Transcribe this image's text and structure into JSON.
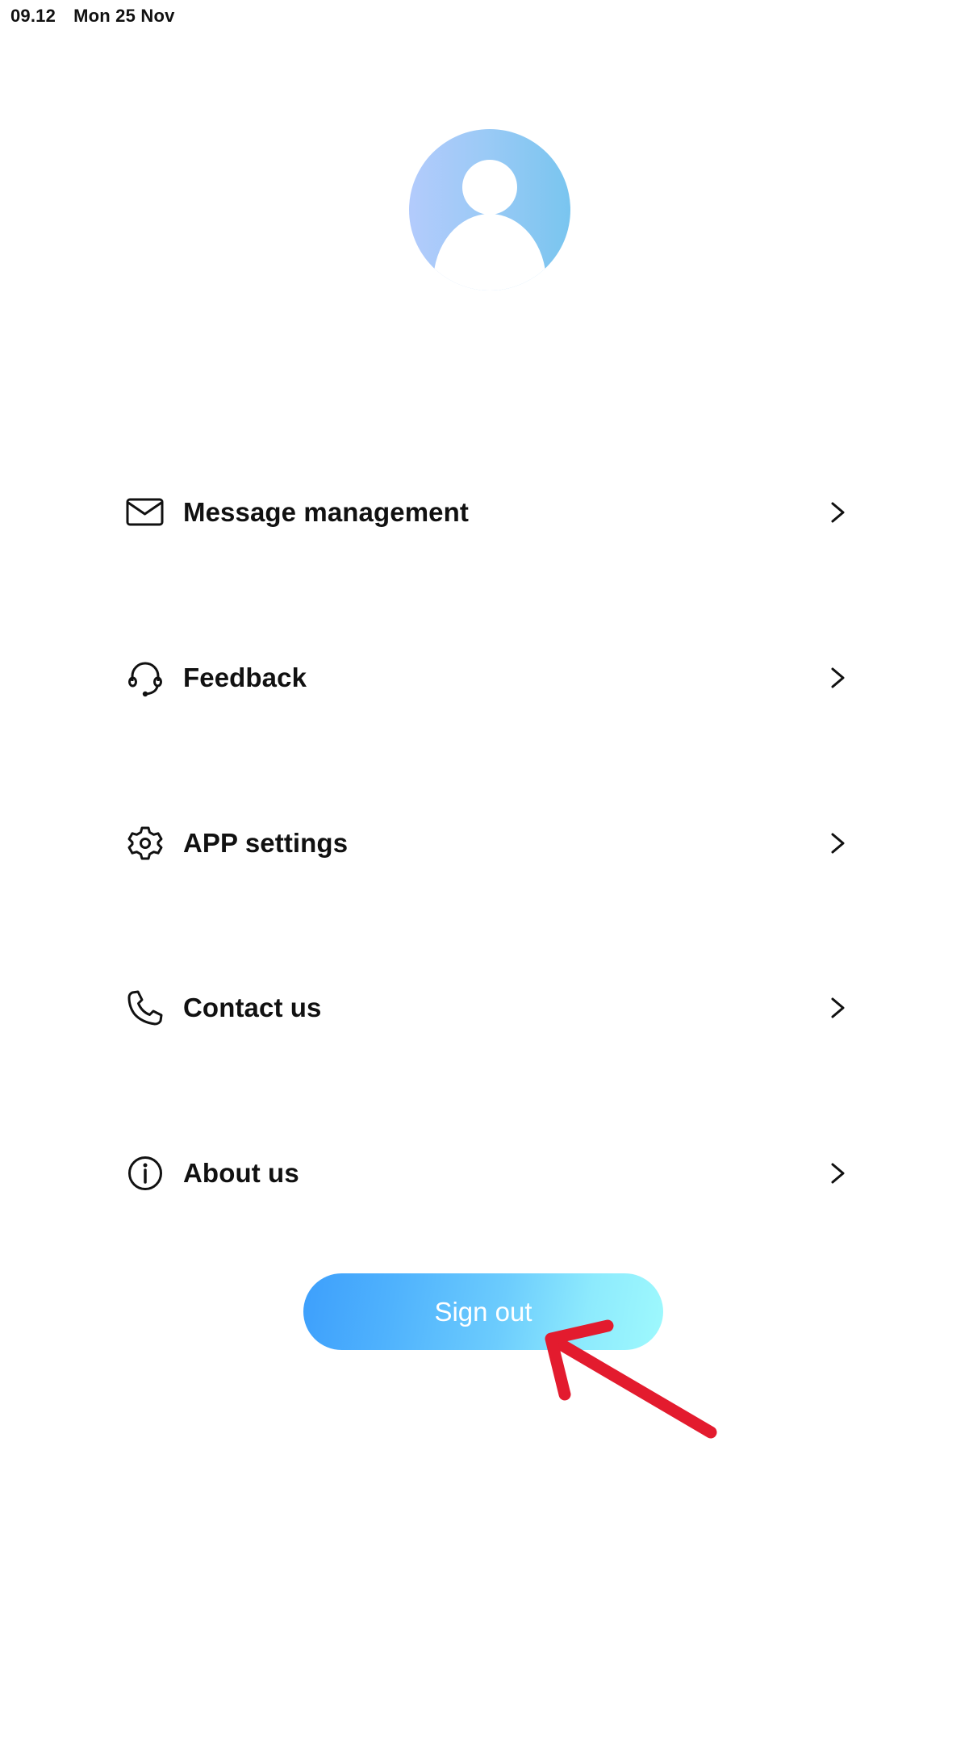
{
  "status_bar": {
    "time": "09.12",
    "date": "Mon 25 Nov"
  },
  "profile": {
    "avatar_icon": "default-user-avatar-icon",
    "avatar_gradient": [
      "#b3cbfc",
      "#79c5ef"
    ]
  },
  "menu": {
    "items": [
      {
        "id": "message-management",
        "label": "Message management",
        "icon": "envelope-icon"
      },
      {
        "id": "feedback",
        "label": "Feedback",
        "icon": "headset-icon"
      },
      {
        "id": "app-settings",
        "label": "APP settings",
        "icon": "gear-icon"
      },
      {
        "id": "contact-us",
        "label": "Contact us",
        "icon": "phone-icon"
      },
      {
        "id": "about-us",
        "label": "About us",
        "icon": "info-icon"
      }
    ],
    "chevron_icon": "chevron-right-icon"
  },
  "signout": {
    "label": "Sign out",
    "gradient": [
      "#3d9ffc",
      "#9ef9fd"
    ]
  },
  "annotation": {
    "type": "arrow",
    "color": "#e31b2e",
    "points_to": "signout-button"
  }
}
